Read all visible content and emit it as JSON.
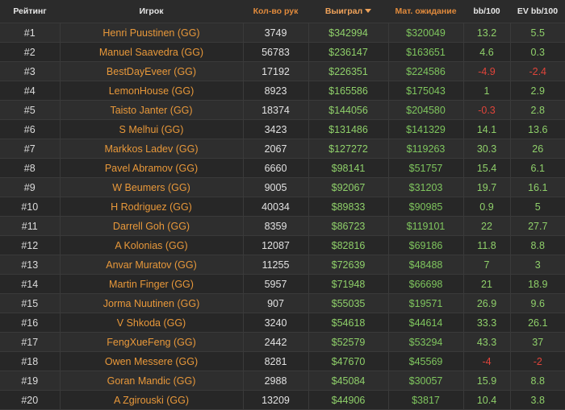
{
  "table": {
    "headers": {
      "rank": "Рейтинг",
      "player": "Игрок",
      "hands": "Кол-во рук",
      "won": "Выиграл",
      "ev": "Мат. ожидание",
      "bb100": "bb/100",
      "evbb100": "EV bb/100"
    },
    "sort_column": "won",
    "sort_direction": "desc",
    "colors": {
      "player_text": "#e8983a",
      "positive_value": "#8fd06a",
      "negative_value": "#e0443a",
      "header_highlight": "#f0a35a",
      "background": "#2b2b2b"
    },
    "rows": [
      {
        "rank": "#1",
        "player": "Henri Puustinen (GG)",
        "hands": "3749",
        "won": "$342994",
        "ev": "$320049",
        "bb100": "13.2",
        "evbb100": "5.5"
      },
      {
        "rank": "#2",
        "player": "Manuel Saavedra (GG)",
        "hands": "56783",
        "won": "$236147",
        "ev": "$163651",
        "bb100": "4.6",
        "evbb100": "0.3"
      },
      {
        "rank": "#3",
        "player": "BestDayEveer (GG)",
        "hands": "17192",
        "won": "$226351",
        "ev": "$224586",
        "bb100": "-4.9",
        "evbb100": "-2.4"
      },
      {
        "rank": "#4",
        "player": "LemonHouse (GG)",
        "hands": "8923",
        "won": "$165586",
        "ev": "$175043",
        "bb100": "1",
        "evbb100": "2.9"
      },
      {
        "rank": "#5",
        "player": "Taisto Janter (GG)",
        "hands": "18374",
        "won": "$144056",
        "ev": "$204580",
        "bb100": "-0.3",
        "evbb100": "2.8"
      },
      {
        "rank": "#6",
        "player": "S Melhui (GG)",
        "hands": "3423",
        "won": "$131486",
        "ev": "$141329",
        "bb100": "14.1",
        "evbb100": "13.6"
      },
      {
        "rank": "#7",
        "player": "Markkos Ladev (GG)",
        "hands": "2067",
        "won": "$127272",
        "ev": "$119263",
        "bb100": "30.3",
        "evbb100": "26"
      },
      {
        "rank": "#8",
        "player": "Pavel Abramov (GG)",
        "hands": "6660",
        "won": "$98141",
        "ev": "$51757",
        "bb100": "15.4",
        "evbb100": "6.1"
      },
      {
        "rank": "#9",
        "player": "W Beumers (GG)",
        "hands": "9005",
        "won": "$92067",
        "ev": "$31203",
        "bb100": "19.7",
        "evbb100": "16.1"
      },
      {
        "rank": "#10",
        "player": "H Rodriguez (GG)",
        "hands": "40034",
        "won": "$89833",
        "ev": "$90985",
        "bb100": "0.9",
        "evbb100": "5"
      },
      {
        "rank": "#11",
        "player": "Darrell Goh (GG)",
        "hands": "8359",
        "won": "$86723",
        "ev": "$119101",
        "bb100": "22",
        "evbb100": "27.7"
      },
      {
        "rank": "#12",
        "player": "A Kolonias (GG)",
        "hands": "12087",
        "won": "$82816",
        "ev": "$69186",
        "bb100": "11.8",
        "evbb100": "8.8"
      },
      {
        "rank": "#13",
        "player": "Anvar Muratov (GG)",
        "hands": "11255",
        "won": "$72639",
        "ev": "$48488",
        "bb100": "7",
        "evbb100": "3"
      },
      {
        "rank": "#14",
        "player": "Martin Finger (GG)",
        "hands": "5957",
        "won": "$71948",
        "ev": "$66698",
        "bb100": "21",
        "evbb100": "18.9"
      },
      {
        "rank": "#15",
        "player": "Jorma Nuutinen (GG)",
        "hands": "907",
        "won": "$55035",
        "ev": "$19571",
        "bb100": "26.9",
        "evbb100": "9.6"
      },
      {
        "rank": "#16",
        "player": "V Shkoda (GG)",
        "hands": "3240",
        "won": "$54618",
        "ev": "$44614",
        "bb100": "33.3",
        "evbb100": "26.1"
      },
      {
        "rank": "#17",
        "player": "FengXueFeng (GG)",
        "hands": "2442",
        "won": "$52579",
        "ev": "$53294",
        "bb100": "43.3",
        "evbb100": "37"
      },
      {
        "rank": "#18",
        "player": "Owen Messere (GG)",
        "hands": "8281",
        "won": "$47670",
        "ev": "$45569",
        "bb100": "-4",
        "evbb100": "-2"
      },
      {
        "rank": "#19",
        "player": "Goran Mandic (GG)",
        "hands": "2988",
        "won": "$45084",
        "ev": "$30057",
        "bb100": "15.9",
        "evbb100": "8.8"
      },
      {
        "rank": "#20",
        "player": "A Zgirouski (GG)",
        "hands": "13209",
        "won": "$44906",
        "ev": "$3817",
        "bb100": "10.4",
        "evbb100": "3.8"
      }
    ]
  }
}
